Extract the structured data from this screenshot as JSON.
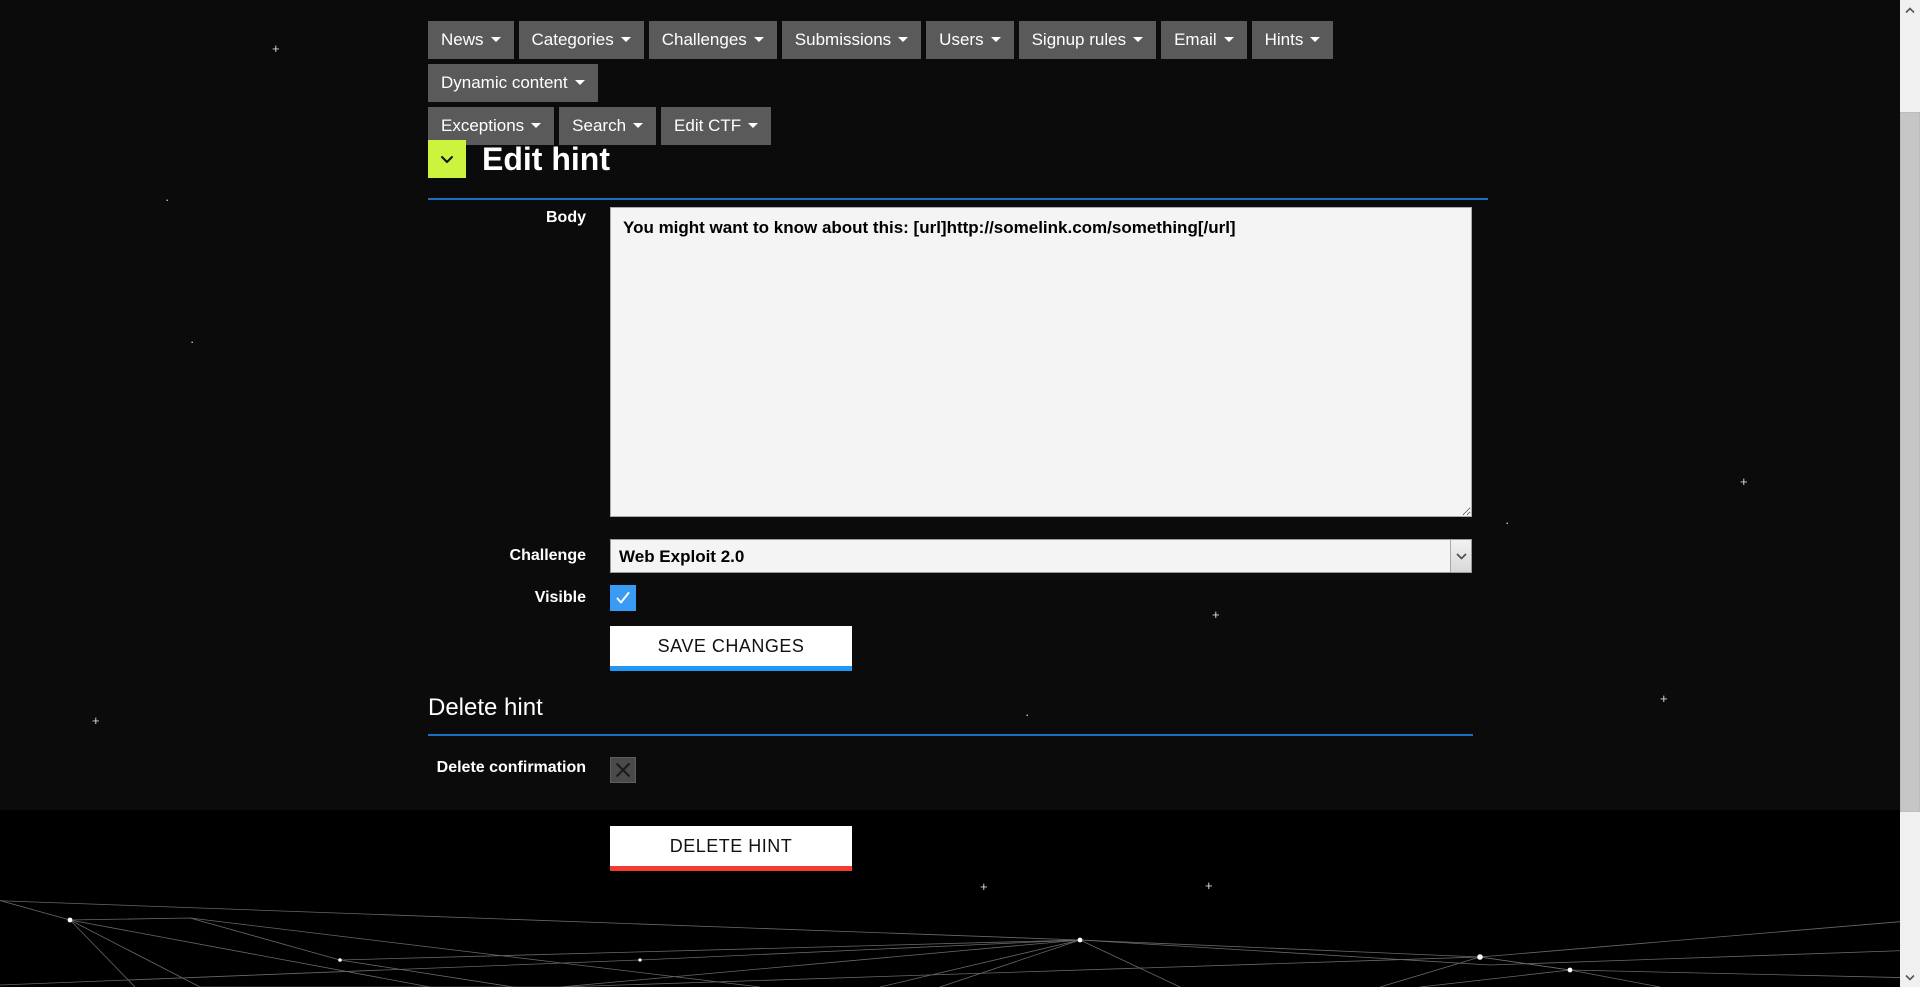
{
  "colors": {
    "background": "#0b0b0b",
    "nav_button": "#5a5a5a",
    "accent_rule": "#1a6fc4",
    "badge_green": "#ccf43f",
    "checkbox_blue": "#3a9bf4",
    "save_underline": "#2196f3",
    "delete_underline": "#f43b30",
    "field_background": "#f4f4f4"
  },
  "nav": {
    "row1": [
      {
        "label": "News",
        "icon": "chevron-down-icon"
      },
      {
        "label": "Categories",
        "icon": "chevron-down-icon"
      },
      {
        "label": "Challenges",
        "icon": "chevron-down-icon"
      },
      {
        "label": "Submissions",
        "icon": "chevron-down-icon"
      },
      {
        "label": "Users",
        "icon": "chevron-down-icon"
      },
      {
        "label": "Signup rules",
        "icon": "chevron-down-icon"
      },
      {
        "label": "Email",
        "icon": "chevron-down-icon"
      },
      {
        "label": "Hints",
        "icon": "chevron-down-icon"
      },
      {
        "label": "Dynamic content",
        "icon": "chevron-down-icon"
      }
    ],
    "row2": [
      {
        "label": "Exceptions",
        "icon": "chevron-down-icon"
      },
      {
        "label": "Search",
        "icon": "chevron-down-icon"
      },
      {
        "label": "Edit CTF",
        "icon": "chevron-down-icon"
      }
    ]
  },
  "page": {
    "title": "Edit hint",
    "badge_icon": "chevron-down-icon"
  },
  "form": {
    "body": {
      "label": "Body",
      "value": "You might want to know about this: [url]http://somelink.com/something[/url]",
      "placeholder": ""
    },
    "challenge": {
      "label": "Challenge",
      "selected": "Web Exploit 2.0",
      "options": [
        "Web Exploit 2.0"
      ],
      "arrow_icon": "chevron-down-icon"
    },
    "visible": {
      "label": "Visible",
      "checked": true,
      "icon": "checkmark-icon"
    },
    "save": {
      "label": "SAVE CHANGES"
    }
  },
  "delete_section": {
    "title": "Delete hint",
    "confirm": {
      "label": "Delete confirmation",
      "checked": false,
      "icon": "broken-image-icon"
    },
    "delete": {
      "label": "DELETE HINT"
    }
  },
  "scrollbar": {
    "up_icon": "chevron-up-icon",
    "down_icon": "chevron-down-icon"
  }
}
